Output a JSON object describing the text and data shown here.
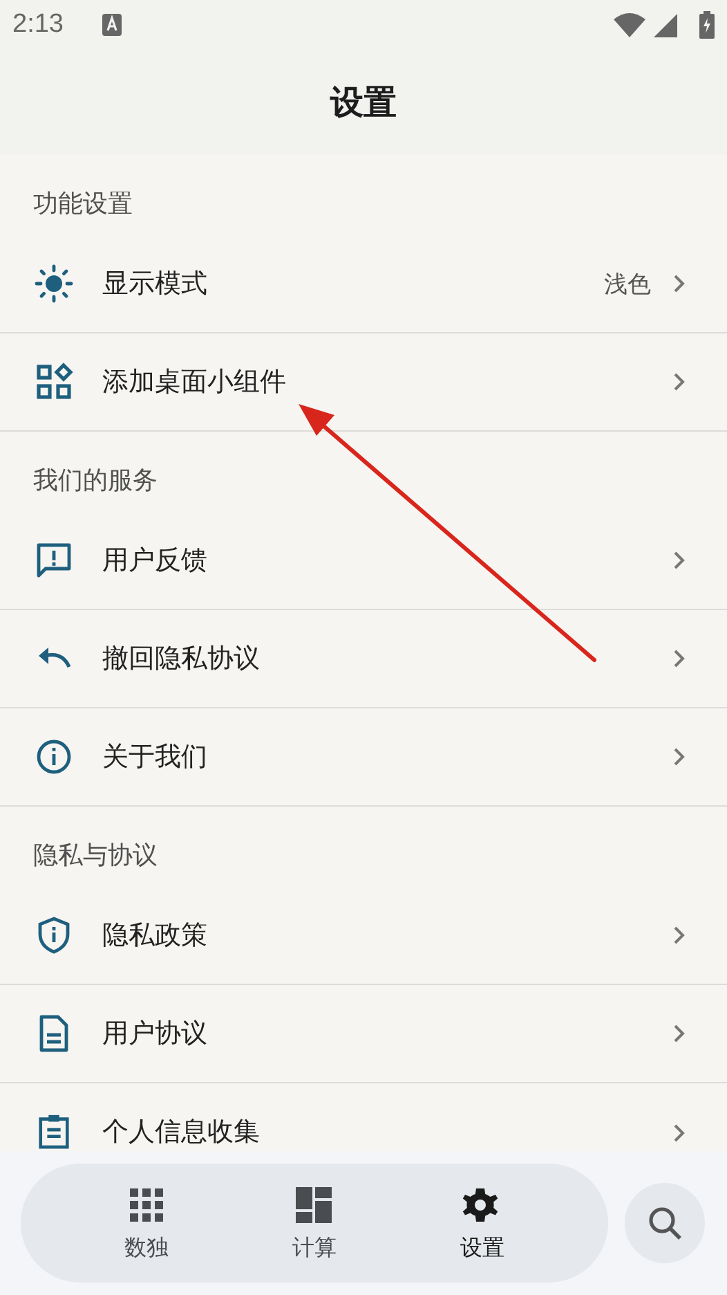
{
  "status_bar": {
    "time": "2:13"
  },
  "header": {
    "title": "设置"
  },
  "sections": [
    {
      "title": "功能设置",
      "items": [
        {
          "kind": "sun",
          "label": "显示模式",
          "value": "浅色"
        },
        {
          "kind": "widgets",
          "label": "添加桌面小组件"
        }
      ]
    },
    {
      "title": "我们的服务",
      "items": [
        {
          "kind": "feedback",
          "label": "用户反馈"
        },
        {
          "kind": "undo",
          "label": "撤回隐私协议"
        },
        {
          "kind": "info",
          "label": "关于我们"
        }
      ]
    },
    {
      "title": "隐私与协议",
      "items": [
        {
          "kind": "shield",
          "label": "隐私政策"
        },
        {
          "kind": "document",
          "label": "用户协议"
        },
        {
          "kind": "clipboard",
          "label": "个人信息收集"
        }
      ]
    }
  ],
  "bottom_nav": [
    {
      "kind": "grid",
      "label": "数独",
      "selected": false
    },
    {
      "kind": "dashboard",
      "label": "计算",
      "selected": false
    },
    {
      "kind": "gear",
      "label": "设置",
      "selected": true
    }
  ],
  "annotation": {
    "kind": "arrow"
  }
}
